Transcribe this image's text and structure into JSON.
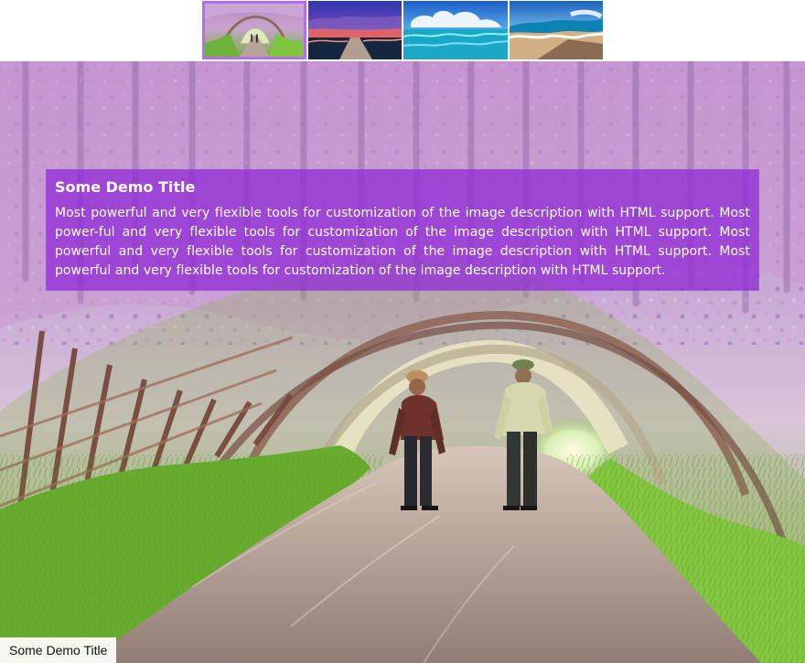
{
  "gallery": {
    "thumbnails": [
      {
        "icon": "wisteria-tunnel-thumbnail",
        "active": true
      },
      {
        "icon": "pier-sunset-thumbnail",
        "active": false
      },
      {
        "icon": "blue-sea-thumbnail",
        "active": false
      },
      {
        "icon": "beach-waves-thumbnail",
        "active": false
      }
    ]
  },
  "slide": {
    "caption_title": "Some Demo Title",
    "caption_text": "Most powerful and very flexible tools for customization of the image description with HTML support. Most power-ful and very flexible tools for customization of the image description with HTML support. Most powerful and very flexible tools for customization of the image description with HTML support. Most powerful and very flexible tools for customization of the image description with HTML support.",
    "bottom_title": "Some Demo Title",
    "caption_color": "#912cd6"
  }
}
